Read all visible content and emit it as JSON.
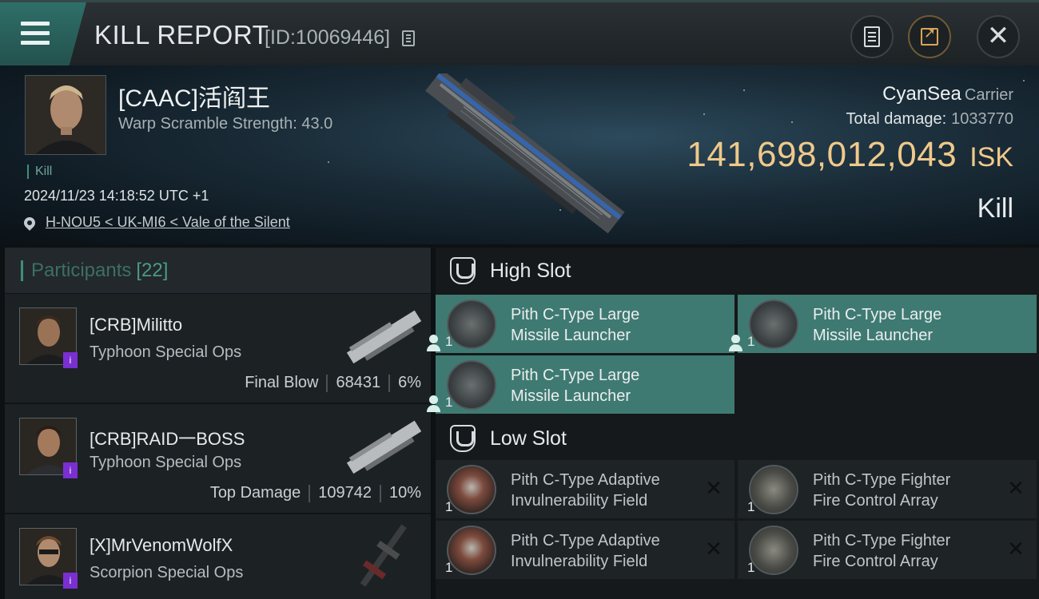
{
  "header": {
    "title": "KILL REPORT",
    "kill_id": "[ID:10069446]"
  },
  "victim": {
    "name": "[CAAC]活阎王",
    "warp_scramble": "Warp Scramble Strength: 43.0",
    "kill_tag": "Kill",
    "datetime": "2024/11/23 14:18:52 UTC +1",
    "location": "H-NOU5 < UK-MI6 < Vale of the Silent",
    "pilot": "CyanSea",
    "ship_class": "Carrier",
    "total_damage_label": "Total damage:",
    "total_damage": "1033770",
    "isk_value": "141,698,012,043",
    "isk_unit": "ISK",
    "result": "Kill"
  },
  "participants": {
    "label": "Participants",
    "count": "[22]",
    "items": [
      {
        "name": "[CRB]Militto",
        "ship": "Typhoon Special Ops",
        "role": "Final Blow",
        "damage": "68431",
        "percent": "6%",
        "badge": "i"
      },
      {
        "name": "[CRB]RAID一BOSS",
        "ship": "Typhoon Special Ops",
        "role": "Top Damage",
        "damage": "109742",
        "percent": "10%",
        "badge": "i"
      },
      {
        "name": "[X]MrVenomWolfX",
        "ship": "Scorpion Special Ops",
        "badge": "i"
      }
    ]
  },
  "fitting": {
    "high_slot_label": "High Slot",
    "low_slot_label": "Low Slot",
    "high": [
      {
        "name_line1": "Pith C-Type Large",
        "name_line2": "Missile Launcher",
        "qty": "1",
        "status": "dropped-icon"
      },
      {
        "name_line1": "Pith C-Type Large",
        "name_line2": "Missile Launcher",
        "qty": "1",
        "status": "dropped-icon"
      },
      {
        "name_line1": "Pith C-Type Large",
        "name_line2": "Missile Launcher",
        "qty": "1",
        "status": "dropped-icon"
      }
    ],
    "low": [
      {
        "name_line1": "Pith C-Type Adaptive",
        "name_line2": "Invulnerability Field",
        "qty": "1",
        "status": "destroyed-icon"
      },
      {
        "name_line1": "Pith C-Type Fighter",
        "name_line2": "Fire Control Array",
        "qty": "1",
        "status": "destroyed-icon"
      },
      {
        "name_line1": "Pith C-Type Adaptive",
        "name_line2": "Invulnerability Field",
        "qty": "1",
        "status": "destroyed-icon"
      },
      {
        "name_line1": "Pith C-Type Fighter",
        "name_line2": "Fire Control Array",
        "qty": "1",
        "status": "destroyed-icon"
      }
    ]
  },
  "colors": {
    "accent_teal": "#3f7a72",
    "isk_gold": "#f0c98a",
    "badge_purple": "#7a2fd1"
  }
}
